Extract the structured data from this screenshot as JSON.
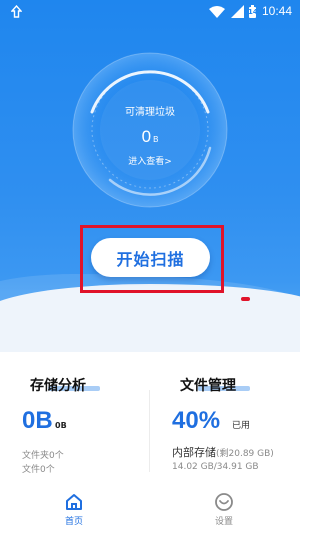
{
  "status_bar": {
    "time": "10:44",
    "battery": "14",
    "icons": [
      "notification-icon",
      "wifi-icon",
      "signal-icon",
      "battery-icon"
    ]
  },
  "cleaner": {
    "title": "可清理垃圾",
    "value": "0",
    "unit": "B",
    "link": "进入查看>"
  },
  "scan_button": {
    "label": "开始扫描"
  },
  "storage_analysis": {
    "title": "存储分析",
    "value": "0B",
    "unit": "0B",
    "folders": "文件夹0个",
    "files": "文件0个"
  },
  "file_manager": {
    "title": "文件管理",
    "percent": "40%",
    "percent_label": "已用",
    "storage_label": "内部存储",
    "remaining": "(剩20.89 GB)",
    "usage": "14.02 GB/34.91 GB"
  },
  "bottom_nav": {
    "home": "首页",
    "settings": "设置"
  },
  "colors": {
    "primary": "#1f86ee",
    "accent_text": "#1f6fe0",
    "highlight": "#e0132a"
  }
}
